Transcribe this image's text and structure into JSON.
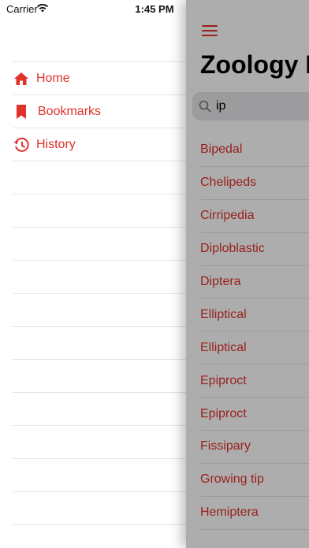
{
  "status_bar": {
    "carrier": "Carrier",
    "time": "1:45 PM"
  },
  "side_menu": {
    "items": [
      {
        "label": "Home",
        "icon": "home-icon"
      },
      {
        "label": "Bookmarks",
        "icon": "bookmark-icon"
      },
      {
        "label": "History",
        "icon": "history-icon"
      }
    ]
  },
  "main": {
    "title": "Zoology D",
    "search": {
      "value": "ip"
    },
    "results": [
      "Bipedal",
      "Chelipeds",
      "Cirripedia",
      "Diploblastic",
      "Diptera",
      "Elliptical",
      "Elliptical",
      "Epiproct",
      "Epiproct",
      "Fissipary",
      "Growing tip",
      "Hemiptera"
    ]
  },
  "colors": {
    "accent": "#e0312b",
    "separator": "#e6e6e6",
    "search_bg": "#e6e6ea"
  }
}
